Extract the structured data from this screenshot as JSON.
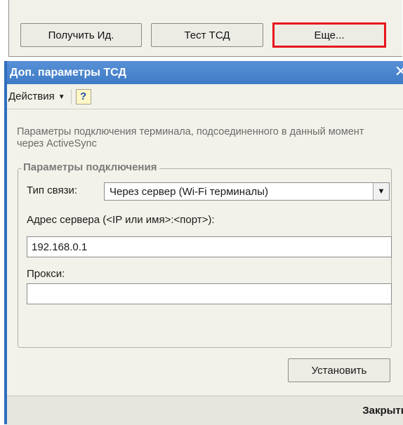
{
  "parent": {
    "buttons": {
      "get_id": "Получить Ид.",
      "test": "Тест ТСД",
      "more": "Еще..."
    }
  },
  "dialog": {
    "title": "Доп. параметры ТСД",
    "close_glyph": "✕",
    "toolbar": {
      "actions_label": "Действия",
      "help_label": "?"
    },
    "info_text": "Параметры подключения терминала, подсоединенного в данный момент через ActiveSync",
    "group": {
      "title": "Параметры подключения",
      "connection_type_label": "Тип связи:",
      "connection_type_value": "Через сервер (Wi-Fi терминалы)",
      "server_address_label": "Адрес сервера (<IP или имя>:<порт>):",
      "server_address_value": "192.168.0.1",
      "proxy_label": "Прокси:",
      "proxy_value": ""
    },
    "set_button": "Установить",
    "close_button": "Закрыть"
  },
  "colors": {
    "titlebar": "#4a86cf",
    "highlight_border": "#e8141b",
    "dialog_bg": "#f3f2ea"
  }
}
